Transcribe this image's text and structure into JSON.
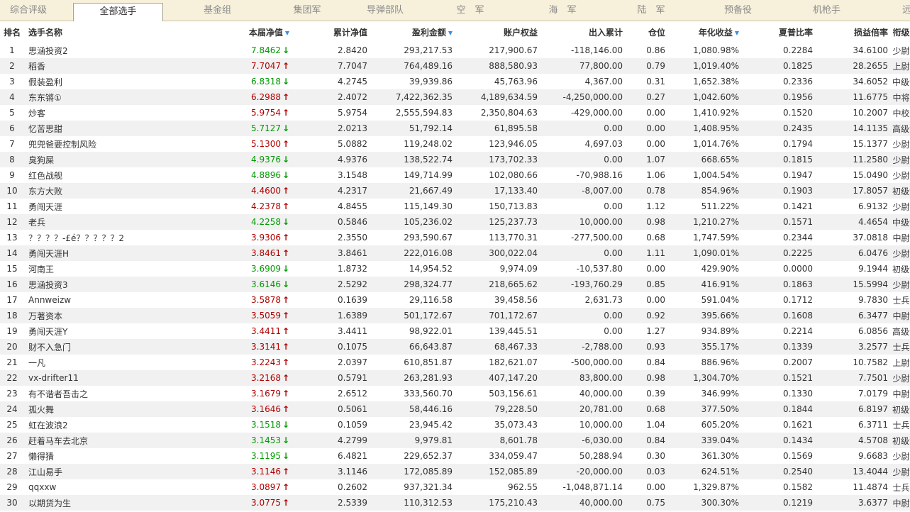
{
  "tabs": [
    {
      "label": "综合评级",
      "active": false
    },
    {
      "label": "全部选手",
      "active": true
    },
    {
      "label": "基金组",
      "active": false
    },
    {
      "label": "集团军",
      "active": false
    },
    {
      "label": "导弹部队",
      "active": false
    },
    {
      "label": "空　军",
      "active": false
    },
    {
      "label": "海　军",
      "active": false
    },
    {
      "label": "陆　军",
      "active": false
    },
    {
      "label": "预备役",
      "active": false
    },
    {
      "label": "机枪手",
      "active": false
    },
    {
      "label": "远",
      "active": false
    }
  ],
  "columns": [
    "排名",
    "选手名称",
    "本届净值",
    "累计净值",
    "盈利金额",
    "账户权益",
    "出入累计",
    "仓位",
    "年化收益",
    "夏普比率",
    "损益倍率",
    "衔级"
  ],
  "sorted_columns": [
    "本届净值",
    "盈利金额",
    "年化收益"
  ],
  "colors": {
    "up": "#b00000",
    "down": "#009900",
    "sort": "#3b8ed8",
    "tabbar": "#f7f1dc",
    "row_alt": "#f1f1f1"
  },
  "rows": [
    {
      "rank": "1",
      "name": "思涵投资2",
      "nav": "7.8462",
      "dir": "down",
      "cum_nav": "2.8420",
      "profit": "293,217.53",
      "equity": "217,900.67",
      "flow": "-118,146.00",
      "position": "0.86",
      "annual": "1,080.98%",
      "sharpe": "0.2284",
      "pl_ratio": "34.6100",
      "rankname": "少尉"
    },
    {
      "rank": "2",
      "name": "稻香",
      "nav": "7.7047",
      "dir": "up",
      "cum_nav": "7.7047",
      "profit": "764,489.16",
      "equity": "888,580.93",
      "flow": "77,800.00",
      "position": "0.79",
      "annual": "1,019.40%",
      "sharpe": "0.1825",
      "pl_ratio": "28.2655",
      "rankname": "上尉"
    },
    {
      "rank": "3",
      "name": "假装盈利",
      "nav": "6.8318",
      "dir": "down",
      "cum_nav": "4.2745",
      "profit": "39,939.86",
      "equity": "45,763.96",
      "flow": "4,367.00",
      "position": "0.31",
      "annual": "1,652.38%",
      "sharpe": "0.2336",
      "pl_ratio": "34.6052",
      "rankname": "中级士官"
    },
    {
      "rank": "4",
      "name": "东东锵①",
      "nav": "6.2988",
      "dir": "up",
      "cum_nav": "2.4072",
      "profit": "7,422,362.35",
      "equity": "4,189,634.59",
      "flow": "-4,250,000.00",
      "position": "0.27",
      "annual": "1,042.60%",
      "sharpe": "0.1956",
      "pl_ratio": "11.6775",
      "rankname": "中将"
    },
    {
      "rank": "5",
      "name": "炒客",
      "nav": "5.9754",
      "dir": "up",
      "cum_nav": "5.9754",
      "profit": "2,555,594.83",
      "equity": "2,350,804.63",
      "flow": "-429,000.00",
      "position": "0.00",
      "annual": "1,410.92%",
      "sharpe": "0.1520",
      "pl_ratio": "10.2007",
      "rankname": "中校"
    },
    {
      "rank": "6",
      "name": "忆苦思甜",
      "nav": "5.7127",
      "dir": "down",
      "cum_nav": "2.0213",
      "profit": "51,792.14",
      "equity": "61,895.58",
      "flow": "0.00",
      "position": "0.00",
      "annual": "1,408.95%",
      "sharpe": "0.2435",
      "pl_ratio": "14.1135",
      "rankname": "高级士官"
    },
    {
      "rank": "7",
      "name": "兜兜爸要控制风险",
      "nav": "5.1300",
      "dir": "up",
      "cum_nav": "5.0882",
      "profit": "119,248.02",
      "equity": "123,946.05",
      "flow": "4,697.03",
      "position": "0.00",
      "annual": "1,014.76%",
      "sharpe": "0.1794",
      "pl_ratio": "15.1377",
      "rankname": "少尉"
    },
    {
      "rank": "8",
      "name": "臭狗屎",
      "nav": "4.9376",
      "dir": "down",
      "cum_nav": "4.9376",
      "profit": "138,522.74",
      "equity": "173,702.33",
      "flow": "0.00",
      "position": "1.07",
      "annual": "668.65%",
      "sharpe": "0.1815",
      "pl_ratio": "11.2580",
      "rankname": "少尉"
    },
    {
      "rank": "9",
      "name": "红色战舰",
      "nav": "4.8896",
      "dir": "down",
      "cum_nav": "3.1548",
      "profit": "149,714.99",
      "equity": "102,080.66",
      "flow": "-70,988.16",
      "position": "1.06",
      "annual": "1,004.54%",
      "sharpe": "0.1947",
      "pl_ratio": "15.0490",
      "rankname": "少尉"
    },
    {
      "rank": "10",
      "name": "东方大败",
      "nav": "4.4600",
      "dir": "up",
      "cum_nav": "4.2317",
      "profit": "21,667.49",
      "equity": "17,133.40",
      "flow": "-8,007.00",
      "position": "0.78",
      "annual": "854.96%",
      "sharpe": "0.1903",
      "pl_ratio": "17.8057",
      "rankname": "初级士官"
    },
    {
      "rank": "11",
      "name": "勇闯天涯",
      "nav": "4.2378",
      "dir": "up",
      "cum_nav": "4.8455",
      "profit": "115,149.30",
      "equity": "150,713.83",
      "flow": "0.00",
      "position": "1.12",
      "annual": "511.22%",
      "sharpe": "0.1421",
      "pl_ratio": "6.9132",
      "rankname": "少尉"
    },
    {
      "rank": "12",
      "name": "老兵",
      "nav": "4.2258",
      "dir": "down",
      "cum_nav": "0.5846",
      "profit": "105,236.02",
      "equity": "125,237.73",
      "flow": "10,000.00",
      "position": "0.98",
      "annual": "1,210.27%",
      "sharpe": "0.1571",
      "pl_ratio": "4.4654",
      "rankname": "中级士官"
    },
    {
      "rank": "13",
      "name": "？？？？-£é？？？？？2",
      "nav": "3.9306",
      "dir": "up",
      "cum_nav": "2.3550",
      "profit": "293,590.67",
      "equity": "113,770.31",
      "flow": "-277,500.00",
      "position": "0.68",
      "annual": "1,747.59%",
      "sharpe": "0.2344",
      "pl_ratio": "37.0818",
      "rankname": "中尉"
    },
    {
      "rank": "14",
      "name": "勇闯天涯H",
      "nav": "3.8461",
      "dir": "up",
      "cum_nav": "3.8461",
      "profit": "222,016.08",
      "equity": "300,022.04",
      "flow": "0.00",
      "position": "1.11",
      "annual": "1,090.01%",
      "sharpe": "0.2225",
      "pl_ratio": "6.0476",
      "rankname": "少尉"
    },
    {
      "rank": "15",
      "name": "河南王",
      "nav": "3.6909",
      "dir": "down",
      "cum_nav": "1.8732",
      "profit": "14,954.52",
      "equity": "9,974.09",
      "flow": "-10,537.80",
      "position": "0.00",
      "annual": "429.90%",
      "sharpe": "0.0000",
      "pl_ratio": "9.1944",
      "rankname": "初级士官"
    },
    {
      "rank": "16",
      "name": "思涵投资3",
      "nav": "3.6146",
      "dir": "down",
      "cum_nav": "2.5292",
      "profit": "298,324.77",
      "equity": "218,665.62",
      "flow": "-193,760.29",
      "position": "0.85",
      "annual": "416.91%",
      "sharpe": "0.1863",
      "pl_ratio": "15.5994",
      "rankname": "少尉"
    },
    {
      "rank": "17",
      "name": "Annweizw",
      "nav": "3.5878",
      "dir": "up",
      "cum_nav": "0.1639",
      "profit": "29,116.58",
      "equity": "39,458.56",
      "flow": "2,631.73",
      "position": "0.00",
      "annual": "591.04%",
      "sharpe": "0.1712",
      "pl_ratio": "9.7830",
      "rankname": "士兵"
    },
    {
      "rank": "18",
      "name": "万著资本",
      "nav": "3.5059",
      "dir": "up",
      "cum_nav": "1.6389",
      "profit": "501,172.67",
      "equity": "701,172.67",
      "flow": "0.00",
      "position": "0.92",
      "annual": "395.66%",
      "sharpe": "0.1608",
      "pl_ratio": "6.3477",
      "rankname": "中尉"
    },
    {
      "rank": "19",
      "name": "勇闯天涯Y",
      "nav": "3.4411",
      "dir": "up",
      "cum_nav": "3.4411",
      "profit": "98,922.01",
      "equity": "139,445.51",
      "flow": "0.00",
      "position": "1.27",
      "annual": "934.89%",
      "sharpe": "0.2214",
      "pl_ratio": "6.0856",
      "rankname": "高级士官"
    },
    {
      "rank": "20",
      "name": "财不入急门",
      "nav": "3.3141",
      "dir": "up",
      "cum_nav": "0.1075",
      "profit": "66,643.87",
      "equity": "68,467.33",
      "flow": "-2,788.00",
      "position": "0.93",
      "annual": "355.17%",
      "sharpe": "0.1339",
      "pl_ratio": "3.2577",
      "rankname": "士兵"
    },
    {
      "rank": "21",
      "name": "一凡",
      "nav": "3.2243",
      "dir": "up",
      "cum_nav": "2.0397",
      "profit": "610,851.87",
      "equity": "182,621.07",
      "flow": "-500,000.00",
      "position": "0.84",
      "annual": "886.96%",
      "sharpe": "0.2007",
      "pl_ratio": "10.7582",
      "rankname": "上尉"
    },
    {
      "rank": "22",
      "name": "vx-drifter11",
      "nav": "3.2168",
      "dir": "up",
      "cum_nav": "0.5791",
      "profit": "263,281.93",
      "equity": "407,147.20",
      "flow": "83,800.00",
      "position": "0.98",
      "annual": "1,304.70%",
      "sharpe": "0.1521",
      "pl_ratio": "7.7501",
      "rankname": "少尉"
    },
    {
      "rank": "23",
      "name": "有不谐者吾击之",
      "nav": "3.1679",
      "dir": "up",
      "cum_nav": "2.6512",
      "profit": "333,560.70",
      "equity": "503,156.61",
      "flow": "40,000.00",
      "position": "0.39",
      "annual": "346.99%",
      "sharpe": "0.1330",
      "pl_ratio": "7.0179",
      "rankname": "中尉"
    },
    {
      "rank": "24",
      "name": "孤火舞",
      "nav": "3.1646",
      "dir": "up",
      "cum_nav": "0.5061",
      "profit": "58,446.16",
      "equity": "79,228.50",
      "flow": "20,781.00",
      "position": "0.68",
      "annual": "377.50%",
      "sharpe": "0.1844",
      "pl_ratio": "6.8197",
      "rankname": "初级士官"
    },
    {
      "rank": "25",
      "name": "虹在波浪2",
      "nav": "3.1518",
      "dir": "down",
      "cum_nav": "0.1059",
      "profit": "23,945.42",
      "equity": "35,073.43",
      "flow": "10,000.00",
      "position": "1.04",
      "annual": "605.20%",
      "sharpe": "0.1621",
      "pl_ratio": "6.3711",
      "rankname": "士兵"
    },
    {
      "rank": "26",
      "name": "赶着马车去北京",
      "nav": "3.1453",
      "dir": "down",
      "cum_nav": "4.2799",
      "profit": "9,979.81",
      "equity": "8,601.78",
      "flow": "-6,030.00",
      "position": "0.84",
      "annual": "339.04%",
      "sharpe": "0.1434",
      "pl_ratio": "4.5708",
      "rankname": "初级士官"
    },
    {
      "rank": "27",
      "name": "懒得猜",
      "nav": "3.1195",
      "dir": "down",
      "cum_nav": "6.4821",
      "profit": "229,652.37",
      "equity": "334,059.47",
      "flow": "50,288.94",
      "position": "0.30",
      "annual": "361.30%",
      "sharpe": "0.1569",
      "pl_ratio": "9.6683",
      "rankname": "少尉"
    },
    {
      "rank": "28",
      "name": "江山易手",
      "nav": "3.1146",
      "dir": "up",
      "cum_nav": "3.1146",
      "profit": "172,085.89",
      "equity": "152,085.89",
      "flow": "-20,000.00",
      "position": "0.03",
      "annual": "624.51%",
      "sharpe": "0.2540",
      "pl_ratio": "13.4044",
      "rankname": "少尉"
    },
    {
      "rank": "29",
      "name": "qqxxw",
      "nav": "3.0897",
      "dir": "up",
      "cum_nav": "0.2602",
      "profit": "937,321.34",
      "equity": "962.55",
      "flow": "-1,048,871.14",
      "position": "0.00",
      "annual": "1,329.87%",
      "sharpe": "0.1582",
      "pl_ratio": "11.4874",
      "rankname": "士兵"
    },
    {
      "rank": "30",
      "name": "以期货为生",
      "nav": "3.0775",
      "dir": "up",
      "cum_nav": "2.5339",
      "profit": "110,312.53",
      "equity": "175,210.43",
      "flow": "40,000.00",
      "position": "0.75",
      "annual": "300.30%",
      "sharpe": "0.1219",
      "pl_ratio": "3.6377",
      "rankname": "中尉"
    }
  ]
}
